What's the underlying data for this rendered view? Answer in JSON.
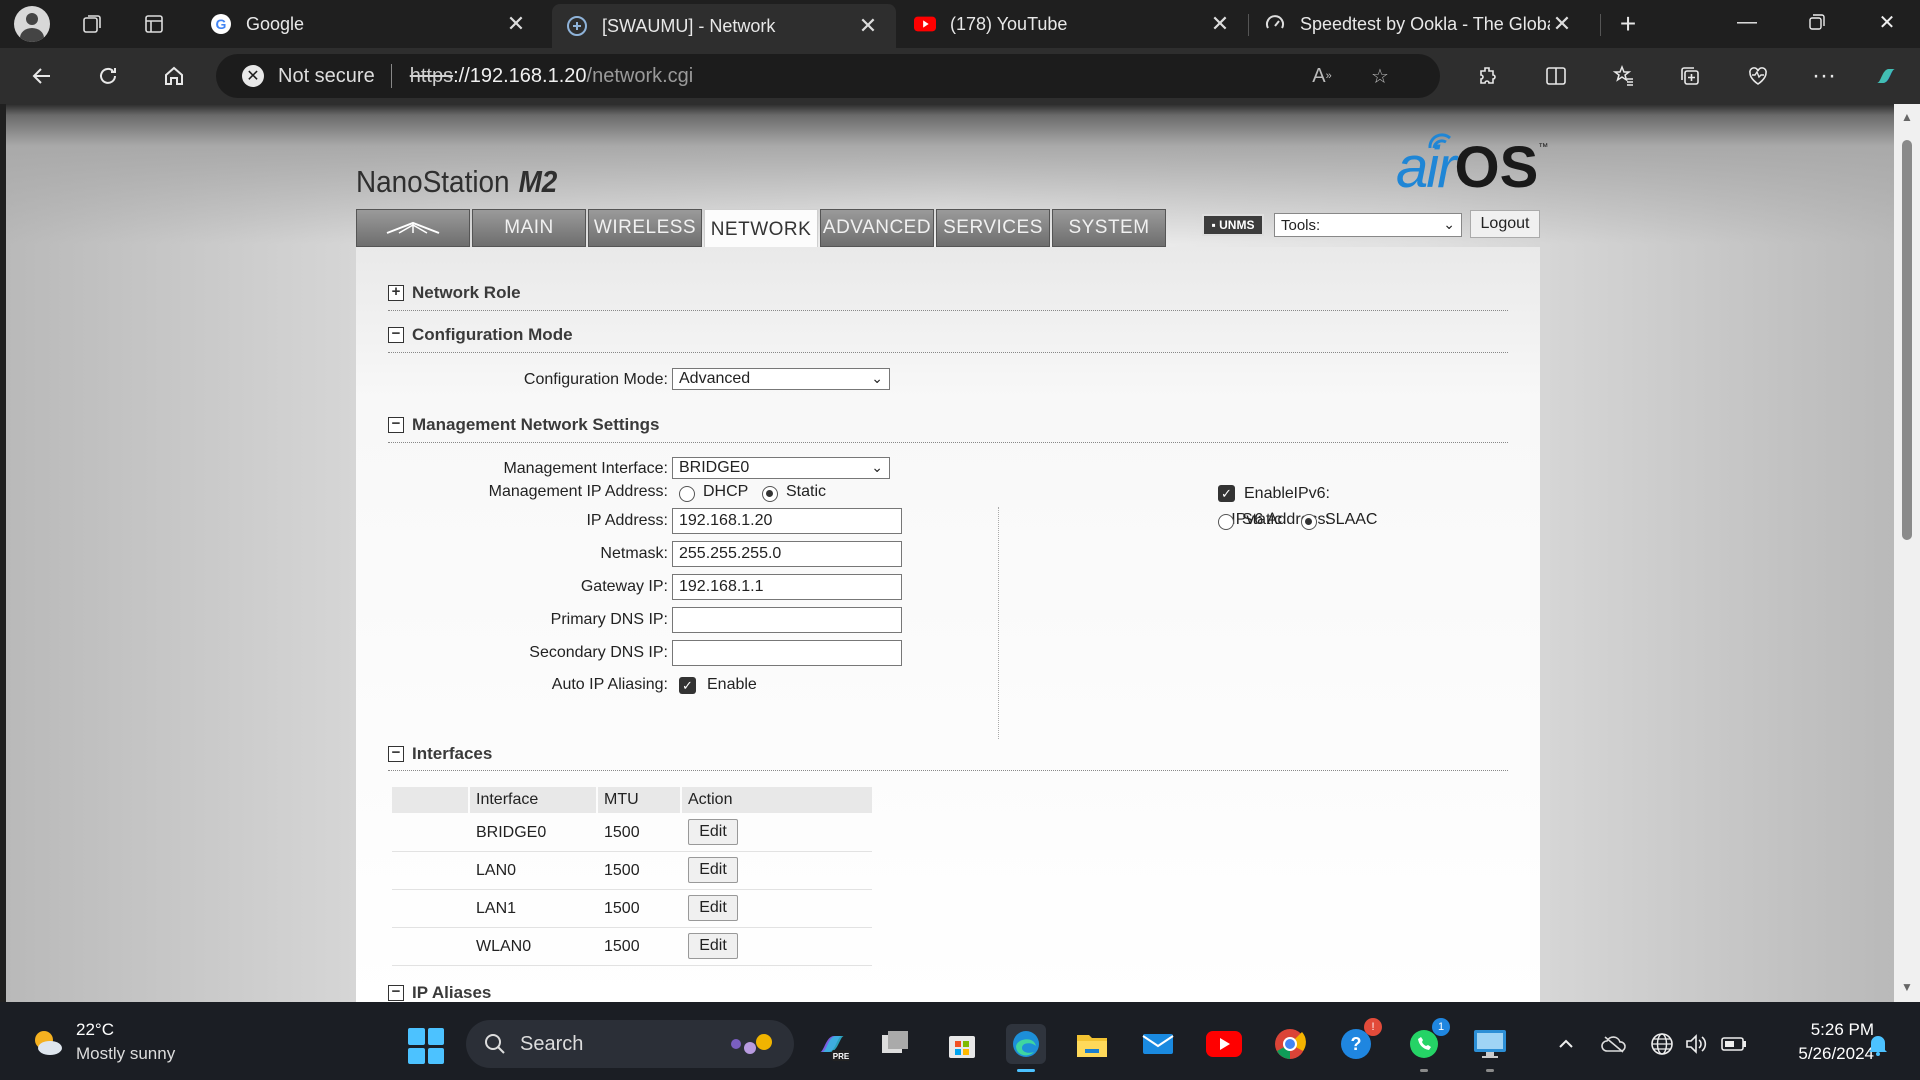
{
  "browser": {
    "tabs": [
      {
        "title": "Google",
        "favicon": "google-icon"
      },
      {
        "title": "[SWAUMU] - Network",
        "favicon": "ubiquiti-icon"
      },
      {
        "title": "(178) YouTube",
        "favicon": "youtube-icon"
      },
      {
        "title": "Speedtest by Ookla - The Global",
        "favicon": "speedtest-icon"
      }
    ],
    "address": {
      "security_label": "Not secure",
      "scheme": "https",
      "host": "://192.168.1.20",
      "path": "/network.cgi"
    }
  },
  "airos": {
    "product_name": "NanoStation",
    "product_model": "M2",
    "logo_air": "air",
    "logo_os": "OS",
    "logo_tm": "™",
    "nav": [
      "MAIN",
      "WIRELESS",
      "NETWORK",
      "ADVANCED",
      "SERVICES",
      "SYSTEM"
    ],
    "active_nav": "NETWORK",
    "unms_label": "UNMS",
    "tools_value": "Tools:",
    "logout_label": "Logout"
  },
  "sections": {
    "network_role": "Network Role",
    "configuration_mode": "Configuration Mode",
    "management": "Management Network Settings",
    "interfaces": "Interfaces",
    "ip_aliases": "IP Aliases"
  },
  "config_mode": {
    "label": "Configuration Mode:",
    "value": "Advanced"
  },
  "management": {
    "interface_label": "Management Interface:",
    "interface_value": "BRIDGE0",
    "ip_address_mode_label": "Management IP Address:",
    "dhcp_label": "DHCP",
    "static_label": "Static",
    "ip_label": "IP Address:",
    "ip_value": "192.168.1.20",
    "netmask_label": "Netmask:",
    "netmask_value": "255.255.255.0",
    "gateway_label": "Gateway IP:",
    "gateway_value": "192.168.1.1",
    "primary_dns_label": "Primary DNS IP:",
    "primary_dns_value": "",
    "secondary_dns_label": "Secondary DNS IP:",
    "secondary_dns_value": "",
    "auto_alias_label": "Auto IP Aliasing:",
    "enable_label": "Enable",
    "ipv6_label": "IPv6:",
    "ipv6_enable_label": "Enable",
    "ipv6_address_label": "IPv6 Address:",
    "ipv6_static_label": "Static",
    "ipv6_slaac_label": "SLAAC"
  },
  "interfaces": {
    "headers": [
      "Interface",
      "MTU",
      "Action"
    ],
    "rows": [
      {
        "name": "BRIDGE0",
        "mtu": "1500",
        "action": "Edit"
      },
      {
        "name": "LAN0",
        "mtu": "1500",
        "action": "Edit"
      },
      {
        "name": "LAN1",
        "mtu": "1500",
        "action": "Edit"
      },
      {
        "name": "WLAN0",
        "mtu": "1500",
        "action": "Edit"
      }
    ]
  },
  "taskbar": {
    "temperature": "22°C",
    "condition": "Mostly sunny",
    "search_label": "Search",
    "time": "5:26 PM",
    "date": "5/26/2024",
    "edge_badge": "!",
    "whatsapp_badge": "1"
  },
  "colors": {
    "airos_blue": "#1f86d6",
    "tab_gray": "#7e7e7e",
    "windows_accent": "#4cc2ff"
  }
}
